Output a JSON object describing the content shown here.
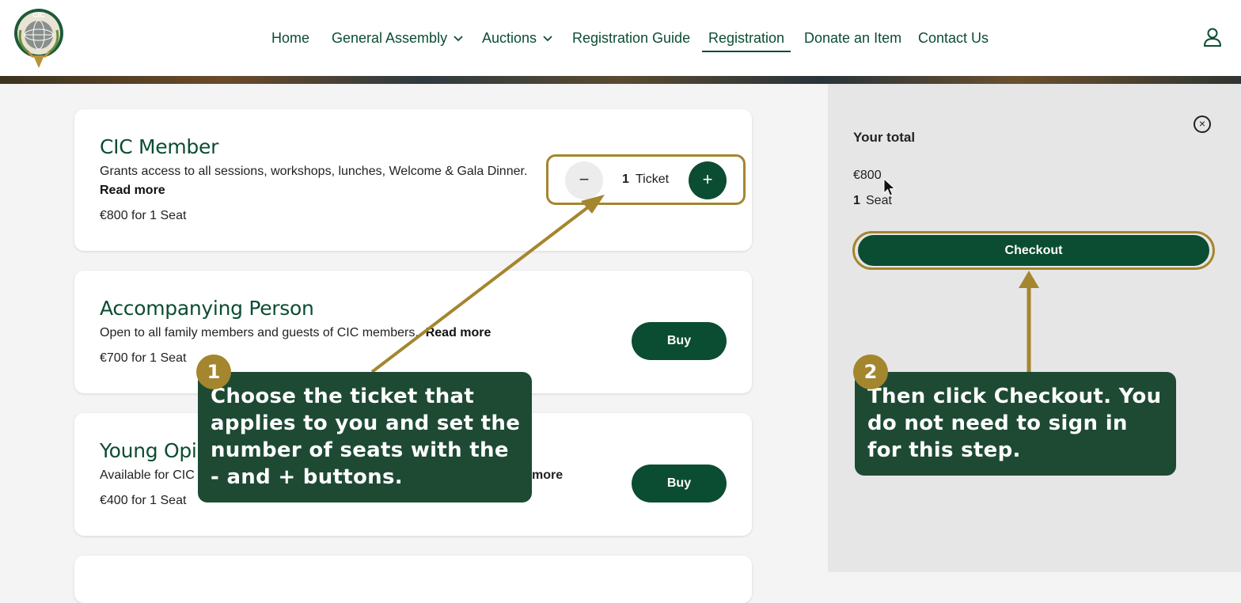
{
  "header": {
    "nav": [
      {
        "label": "Home"
      },
      {
        "label": "General Assembly"
      },
      {
        "label": "Auctions"
      },
      {
        "label": "Registration Guide"
      },
      {
        "label": "Registration"
      },
      {
        "label": "Donate an Item"
      },
      {
        "label": "Contact Us"
      }
    ],
    "logo_text": "CIC"
  },
  "tickets": [
    {
      "title": "CIC Member",
      "desc": "Grants access to all sessions, workshops, lunches, Welcome & Gala Dinner.",
      "read_more": "Read more",
      "price": "€800 for 1 Seat",
      "stepper": {
        "minus": "−",
        "plus": "+",
        "count": "1",
        "unit": "Ticket"
      }
    },
    {
      "title": "Accompanying Person",
      "desc": "Open to all family members and guests of CIC members.",
      "read_more": "Read more",
      "price": "€700 for 1 Seat",
      "button": "Buy"
    },
    {
      "title": "Young Opin",
      "desc": "Available for CIC",
      "read_more": "more",
      "price": "€400 for 1 Seat",
      "button": "Buy"
    }
  ],
  "cart": {
    "title": "Your total",
    "amount": "€800",
    "seat_count": "1",
    "seat_label": "Seat",
    "checkout": "Checkout",
    "close": "×"
  },
  "callouts": [
    {
      "number": "1",
      "text": "Choose the ticket that applies to you and set the number of seats with the - and + buttons."
    },
    {
      "number": "2",
      "text": "Then click Checkout. You do not need to sign in for this step."
    }
  ],
  "colors": {
    "brand_green": "#0b4d32",
    "accent_gold": "#a4862e",
    "callout_green": "#1e4a34"
  }
}
